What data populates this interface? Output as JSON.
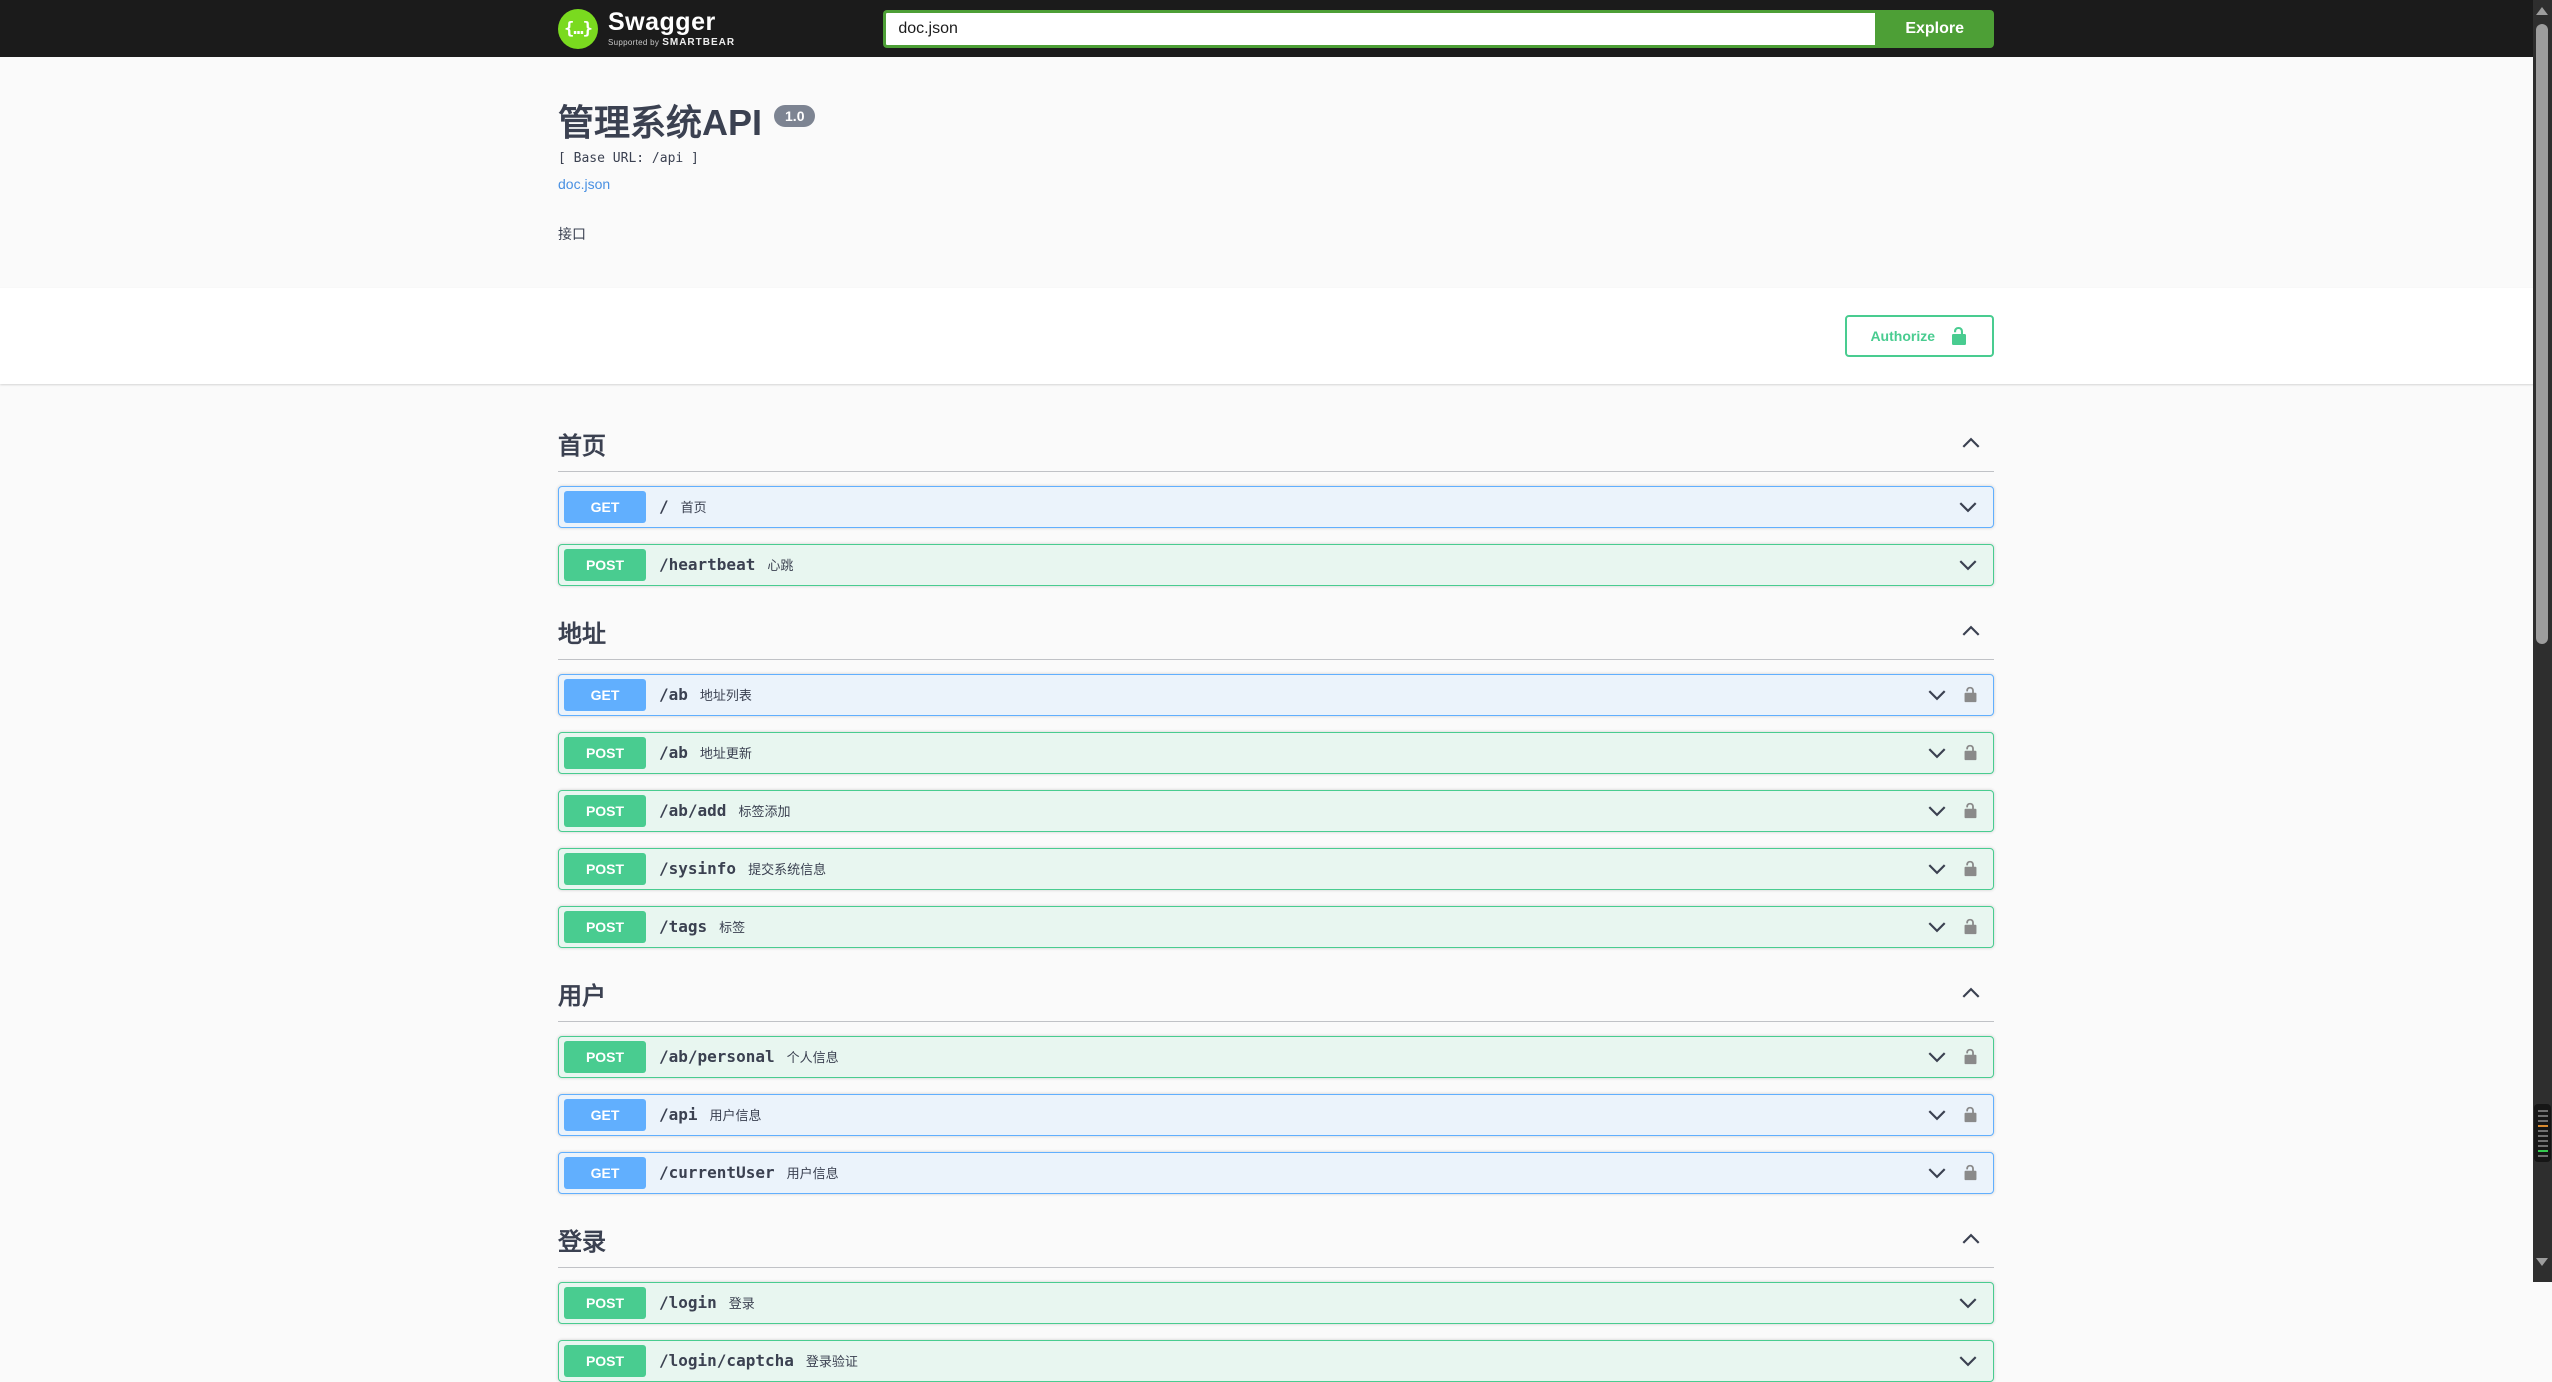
{
  "topbar": {
    "logo_glyph": "{…}",
    "logo_title": "Swagger",
    "supported_by": "Supported by",
    "smartbear": "SMARTBEAR",
    "search_value": "doc.json",
    "explore_label": "Explore"
  },
  "info": {
    "title": "管理系统API",
    "version": "1.0",
    "base_url_label": "[ Base URL: /api ]",
    "spec_link": "doc.json",
    "description": "接口"
  },
  "auth": {
    "authorize_label": "Authorize"
  },
  "colors": {
    "topbar_bg": "#1b1b1b",
    "explore_green": "#4d9f36",
    "logo_green": "#7ada1f",
    "get_blue": "#61affe",
    "post_green": "#49cc90",
    "link_blue": "#4990e2",
    "text": "#3b4151",
    "version_badge_bg": "#7d8492",
    "lock_gray": "#8a8a8a"
  },
  "icons": {
    "logo": "swagger-braces",
    "authorize_lock": "padlock-unlocked-green",
    "row_lock": "padlock-unlocked-gray",
    "section_chevron": "chevron-up",
    "row_chevron": "chevron-down",
    "scroll_up": "▲",
    "scroll_down": "▼"
  },
  "sections": [
    {
      "title": "首页",
      "operations": [
        {
          "method": "GET",
          "path": "/",
          "summary": "首页",
          "lock": false
        },
        {
          "method": "POST",
          "path": "/heartbeat",
          "summary": "心跳",
          "lock": false
        }
      ]
    },
    {
      "title": "地址",
      "operations": [
        {
          "method": "GET",
          "path": "/ab",
          "summary": "地址列表",
          "lock": true
        },
        {
          "method": "POST",
          "path": "/ab",
          "summary": "地址更新",
          "lock": true
        },
        {
          "method": "POST",
          "path": "/ab/add",
          "summary": "标签添加",
          "lock": true
        },
        {
          "method": "POST",
          "path": "/sysinfo",
          "summary": "提交系统信息",
          "lock": true
        },
        {
          "method": "POST",
          "path": "/tags",
          "summary": "标签",
          "lock": true
        }
      ]
    },
    {
      "title": "用户",
      "operations": [
        {
          "method": "POST",
          "path": "/ab/personal",
          "summary": "个人信息",
          "lock": true
        },
        {
          "method": "GET",
          "path": "/api",
          "summary": "用户信息",
          "lock": true
        },
        {
          "method": "GET",
          "path": "/currentUser",
          "summary": "用户信息",
          "lock": true
        }
      ]
    },
    {
      "title": "登录",
      "operations": [
        {
          "method": "POST",
          "path": "/login",
          "summary": "登录",
          "lock": false
        },
        {
          "method": "POST",
          "path": "/login/captcha",
          "summary": "登录验证",
          "lock": false
        }
      ]
    }
  ]
}
